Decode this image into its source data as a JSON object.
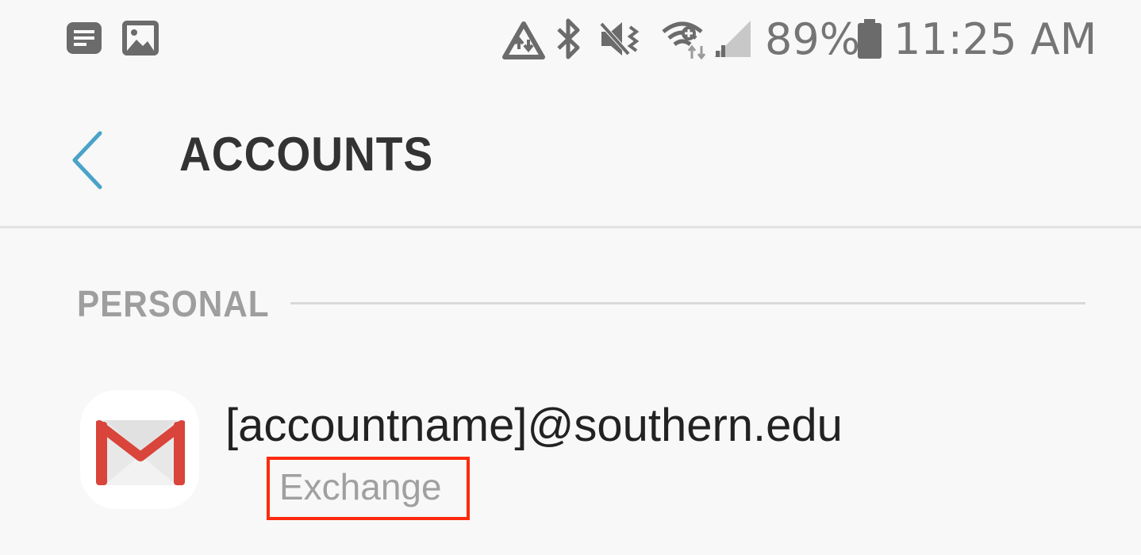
{
  "status_bar": {
    "battery_percent": "89%",
    "time": "11:25 AM",
    "battery_level": 0.89,
    "icons": [
      "notification-note-icon",
      "gallery-icon",
      "data-saver-icon",
      "bluetooth-icon",
      "vibrate-mute-icon",
      "wifi-icon",
      "signal-icon",
      "battery-icon"
    ]
  },
  "header": {
    "title": "ACCOUNTS",
    "back_icon": "chevron-left-icon",
    "accent_color": "#4aa3c8"
  },
  "section": {
    "label": "PERSONAL"
  },
  "accounts": [
    {
      "email": "[accountname]@southern.edu",
      "type": "Exchange",
      "icon": "gmail-icon",
      "highlight_color": "#ff2a0d"
    }
  ]
}
